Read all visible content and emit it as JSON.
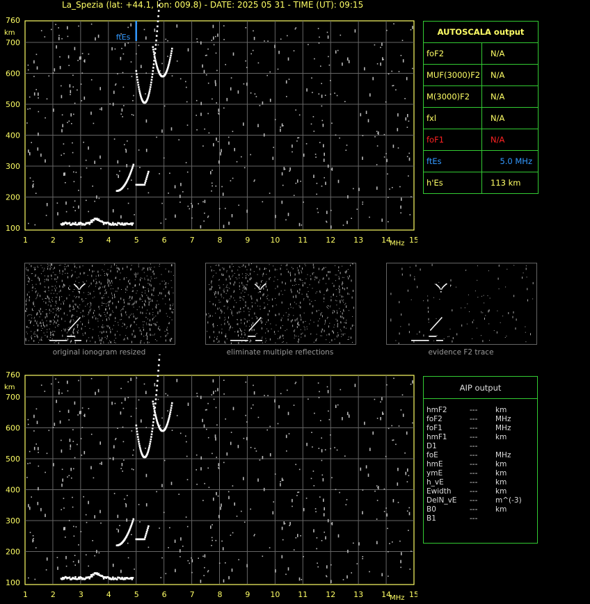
{
  "title": "La_Spezia (lat: +44.1, lon: 009.8) - DATE: 2025 05 31 - TIME (UT): 09:15",
  "axes": {
    "y_ticks": [
      "760",
      "700",
      "600",
      "500",
      "400",
      "300",
      "200",
      "100"
    ],
    "y_unit": "km",
    "x_ticks": [
      "1",
      "2",
      "3",
      "4",
      "5",
      "6",
      "7",
      "8",
      "9",
      "10",
      "11",
      "12",
      "13",
      "14",
      "15"
    ],
    "x_unit": "MHz",
    "ftEs_marker": "ftEs"
  },
  "autoscala": {
    "title": "AUTOSCALA output",
    "rows": [
      {
        "key": "foF2",
        "value": "N/A",
        "color": "#ffff66"
      },
      {
        "key": "MUF(3000)F2",
        "value": "N/A",
        "color": "#ffff66"
      },
      {
        "key": "M(3000)F2",
        "value": "N/A",
        "color": "#ffff66"
      },
      {
        "key": "fxl",
        "value": "N/A",
        "color": "#ffff66"
      },
      {
        "key": "foF1",
        "value": "N/A",
        "color": "#ff2222"
      },
      {
        "key": "ftEs",
        "value": "5.0 MHz",
        "color": "#3399ff"
      },
      {
        "key": "h'Es",
        "value": "113    km",
        "color": "#ffff66"
      }
    ]
  },
  "thumbnails": [
    {
      "caption": "original ionogram resized"
    },
    {
      "caption": "eliminate multiple reflections"
    },
    {
      "caption": "evidence F2 trace"
    }
  ],
  "aip": {
    "title": "AIP output",
    "rows": [
      {
        "p": "hmF2",
        "v": "---",
        "u": "km"
      },
      {
        "p": "foF2",
        "v": "---",
        "u": "MHz"
      },
      {
        "p": "foF1",
        "v": "---",
        "u": "MHz"
      },
      {
        "p": "hmF1",
        "v": "---",
        "u": "km"
      },
      {
        "p": "D1",
        "v": "---",
        "u": ""
      },
      {
        "p": "foE",
        "v": "---",
        "u": "MHz"
      },
      {
        "p": "hmE",
        "v": "---",
        "u": "km"
      },
      {
        "p": "ymE",
        "v": "---",
        "u": "km"
      },
      {
        "p": "h_vE",
        "v": "---",
        "u": "km"
      },
      {
        "p": "Ewidth",
        "v": "---",
        "u": "km"
      },
      {
        "p": "DelN_vE",
        "v": "---",
        "u": "m^(-3)"
      },
      {
        "p": "B0",
        "v": "---",
        "u": "km"
      },
      {
        "p": "B1",
        "v": "---",
        "u": ""
      }
    ]
  }
}
